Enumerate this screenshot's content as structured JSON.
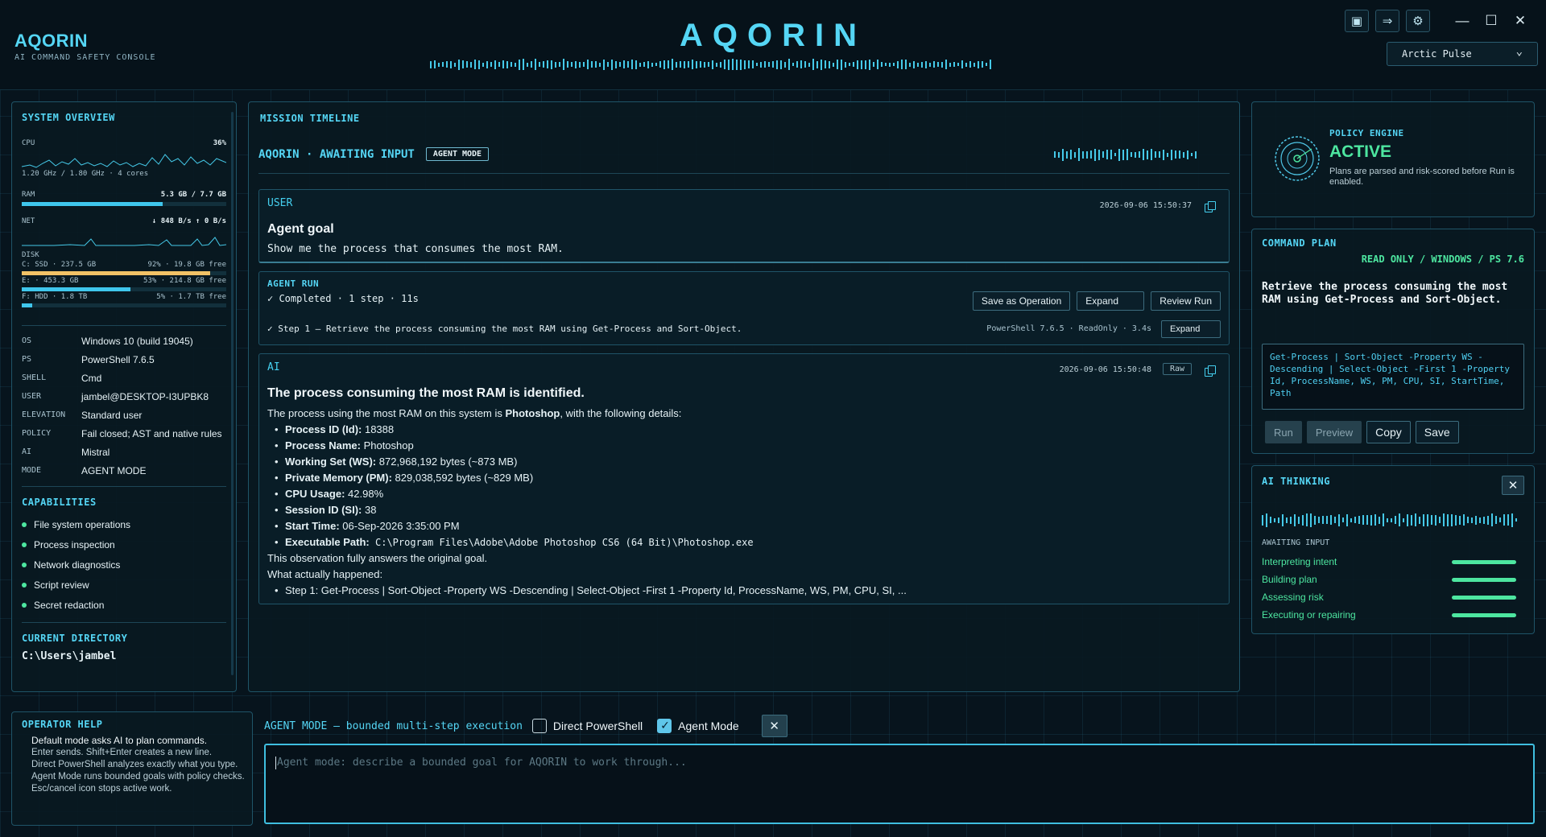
{
  "header": {
    "brand_name": "AQORIN",
    "brand_sub": "AI COMMAND SAFETY CONSOLE",
    "center_title": "AQORIN",
    "theme_selected": "Arctic Pulse"
  },
  "icons": {
    "pin": "▣",
    "export": "⇒",
    "settings": "⚙",
    "minimize": "—",
    "maximize": "☐",
    "close": "✕",
    "chevron": "⌄"
  },
  "colors": {
    "accent": "#55d6f5",
    "success": "#4de6a0",
    "warning": "#f2c266",
    "background": "#07141d"
  },
  "system": {
    "title": "SYSTEM OVERVIEW",
    "cpu_label": "CPU",
    "cpu_value": "36%",
    "cpu_detail": "1.20 GHz / 1.80 GHz · 4 cores",
    "ram_label": "RAM",
    "ram_value": "5.3 GB / 7.7 GB",
    "ram_fraction": 0.69,
    "net_label": "NET",
    "net_value": "↓ 848 B/s  ↑ 0 B/s",
    "disk_label": "DISK",
    "disks": [
      {
        "left": "C: SSD · 237.5 GB",
        "right": "92% · 19.8 GB free",
        "fraction": 0.92,
        "color": "#f2c266"
      },
      {
        "left": "E: · 453.3 GB",
        "right": "53% · 214.8 GB free",
        "fraction": 0.53,
        "color": "#3fc6ec"
      },
      {
        "left": "F: HDD · 1.8 TB",
        "right": "5% · 1.7 TB free",
        "fraction": 0.05,
        "color": "#3fc6ec"
      }
    ],
    "info": [
      {
        "k": "OS",
        "v": "Windows 10 (build 19045)"
      },
      {
        "k": "PS",
        "v": "PowerShell 7.6.5"
      },
      {
        "k": "SHELL",
        "v": "Cmd"
      },
      {
        "k": "USER",
        "v": "jambel@DESKTOP-I3UPBK8"
      },
      {
        "k": "ELEVATION",
        "v": "Standard user"
      },
      {
        "k": "POLICY",
        "v": "Fail closed; AST and native rules"
      },
      {
        "k": "AI",
        "v": "Mistral"
      },
      {
        "k": "MODE",
        "v": "AGENT MODE"
      }
    ],
    "capabilities_title": "CAPABILITIES",
    "capabilities": [
      "File system operations",
      "Process inspection",
      "Network diagnostics",
      "Script review",
      "Secret redaction"
    ],
    "cwd_title": "CURRENT DIRECTORY",
    "cwd": "C:\\Users\\jambel"
  },
  "timeline": {
    "title": "MISSION TIMELINE",
    "status": "AQORIN · AWAITING INPUT",
    "mode_badge": "AGENT MODE",
    "user_card": {
      "role": "USER",
      "timestamp": "2026-09-06 15:50:37",
      "heading": "Agent goal",
      "text": "Show me the process that consumes the most RAM."
    },
    "run_card": {
      "label": "AGENT RUN",
      "summary": "✓ Completed · 1 step · 11s",
      "btn_save": "Save as Operation",
      "btn_expand": "Expand",
      "btn_review": "Review Run",
      "step": "✓ Step 1 — Retrieve the process consuming the most RAM using Get-Process and Sort-Object.",
      "step_meta": "PowerShell 7.6.5 · ReadOnly · 3.4s",
      "step_expand": "Expand"
    },
    "ai_card": {
      "role": "AI",
      "timestamp": "2026-09-06 15:50:48",
      "raw": "Raw",
      "heading": "The process consuming the most RAM is identified.",
      "intro_prefix": "The process using the most RAM on this system is ",
      "intro_bold": "Photoshop",
      "intro_suffix": ", with the following details:",
      "details": [
        {
          "k": "Process ID (Id):",
          "v": " 18388"
        },
        {
          "k": "Process Name:",
          "v": " Photoshop"
        },
        {
          "k": "Working Set (WS):",
          "v": " 872,968,192 bytes (~873 MB)"
        },
        {
          "k": "Private Memory (PM):",
          "v": " 829,038,592 bytes (~829 MB)"
        },
        {
          "k": "CPU Usage:",
          "v": " 42.98%"
        },
        {
          "k": "Session ID (SI):",
          "v": " 38"
        },
        {
          "k": "Start Time:",
          "v": " 06-Sep-2026 3:35:00 PM"
        }
      ],
      "path_label": "Executable Path:",
      "path_value": " C:\\Program Files\\Adobe\\Adobe Photoshop CS6 (64 Bit)\\Photoshop.exe",
      "closing": "This observation fully answers the original goal.",
      "happened": "What actually happened:",
      "happened_step": "Step 1: Get-Process | Sort-Object -Property WS -Descending | Select-Object -First 1 -Property Id, ProcessName, WS, PM, CPU, SI, ..."
    }
  },
  "policy": {
    "label": "POLICY ENGINE",
    "status": "ACTIVE",
    "desc": "Plans are parsed and risk-scored before Run is enabled."
  },
  "plan": {
    "title": "COMMAND PLAN",
    "tag": "READ ONLY / WINDOWS / PS 7.6",
    "desc": "Retrieve the process consuming the most RAM using Get-Process and Sort-Object.",
    "code": "Get-Process | Sort-Object -Property WS -Descending | Select-Object -First 1 -Property Id, ProcessName, WS, PM, CPU, SI, StartTime, Path",
    "btn_run": "Run",
    "btn_preview": "Preview",
    "btn_copy": "Copy",
    "btn_save": "Save"
  },
  "thinking": {
    "title": "AI THINKING",
    "state": "AWAITING INPUT",
    "steps": [
      "Interpreting intent",
      "Building plan",
      "Assessing risk",
      "Executing or repairing"
    ]
  },
  "help": {
    "title": "OPERATOR HELP",
    "lines": [
      "Default mode asks AI to plan commands.",
      "Enter sends. Shift+Enter creates a new line.",
      "Direct PowerShell analyzes exactly what you type.",
      "Agent Mode runs bounded goals with policy checks.",
      "Esc/cancel icon stops active work."
    ]
  },
  "composer": {
    "mode_label": "AGENT MODE — bounded multi-step execution",
    "direct_ps": "Direct PowerShell",
    "agent_mode": "Agent Mode",
    "placeholder": "Agent mode: describe a bounded goal for AQORIN to work through..."
  }
}
